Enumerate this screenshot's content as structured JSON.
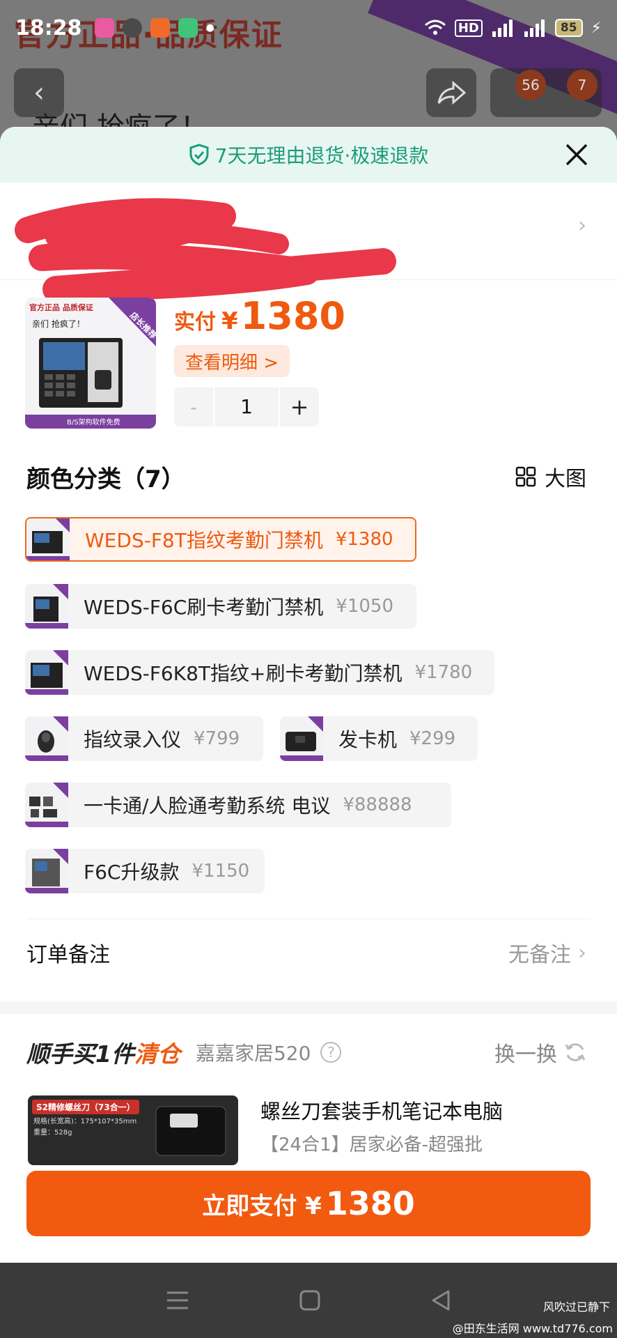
{
  "status_bar": {
    "time": "18:28",
    "battery": "85"
  },
  "background": {
    "banner": "官方正品·品质保证",
    "handwriting": "亲们 抢疯了！",
    "cart_count": "56",
    "msg_count": "7"
  },
  "guarantee": {
    "text": "7天无理由退货·极速退款"
  },
  "product": {
    "pay_label": "实付",
    "currency": "¥",
    "price": "1380",
    "detail_label": "查看明细 >",
    "quantity": "1",
    "minus": "-",
    "plus": "+",
    "thumb_banner": "官方正品 品质保证",
    "thumb_ribbon": "店长推荐",
    "thumb_footer": "B/S架构软件免费",
    "thumb_hand": "亲们 抢疯了！"
  },
  "variants": {
    "title": "颜色分类（7）",
    "bigview_label": "大图",
    "options": [
      {
        "name": "WEDS-F8T指纹考勤门禁机",
        "price": "¥1380"
      },
      {
        "name": "WEDS-F6C刷卡考勤门禁机",
        "price": "¥1050"
      },
      {
        "name": "WEDS-F6K8T指纹+刷卡考勤门禁机",
        "price": "¥1780"
      },
      {
        "name": "指纹录入仪",
        "price": "¥799"
      },
      {
        "name": "发卡机",
        "price": "¥299"
      },
      {
        "name": "一卡通/人脸通考勤系统 电议",
        "price": "¥88888"
      },
      {
        "name": "F6C升级款",
        "price": "¥1150"
      }
    ]
  },
  "order_note": {
    "label": "订单备注",
    "value": "无备注"
  },
  "promo": {
    "title_a": "顺手买1件",
    "title_b": "清仓",
    "shop": "嘉嘉家居520",
    "swap_label": "换一换",
    "item_title": "螺丝刀套装手机笔记本电脑",
    "item_sub": "【24合1】居家必备-超强批",
    "img_tag": "S2精修螺丝刀（73合一）",
    "img_spec1": "规格(长宽高)：175*107*35mm",
    "img_spec2": "重量：528g"
  },
  "pay": {
    "label": "立即支付 ¥",
    "amount": "1380"
  },
  "watermark": {
    "line1": "风吹过已静下",
    "line2": "@田东生活网 www.td776.com"
  },
  "colors": {
    "accent": "#f25a10",
    "green": "#1a9d78"
  }
}
